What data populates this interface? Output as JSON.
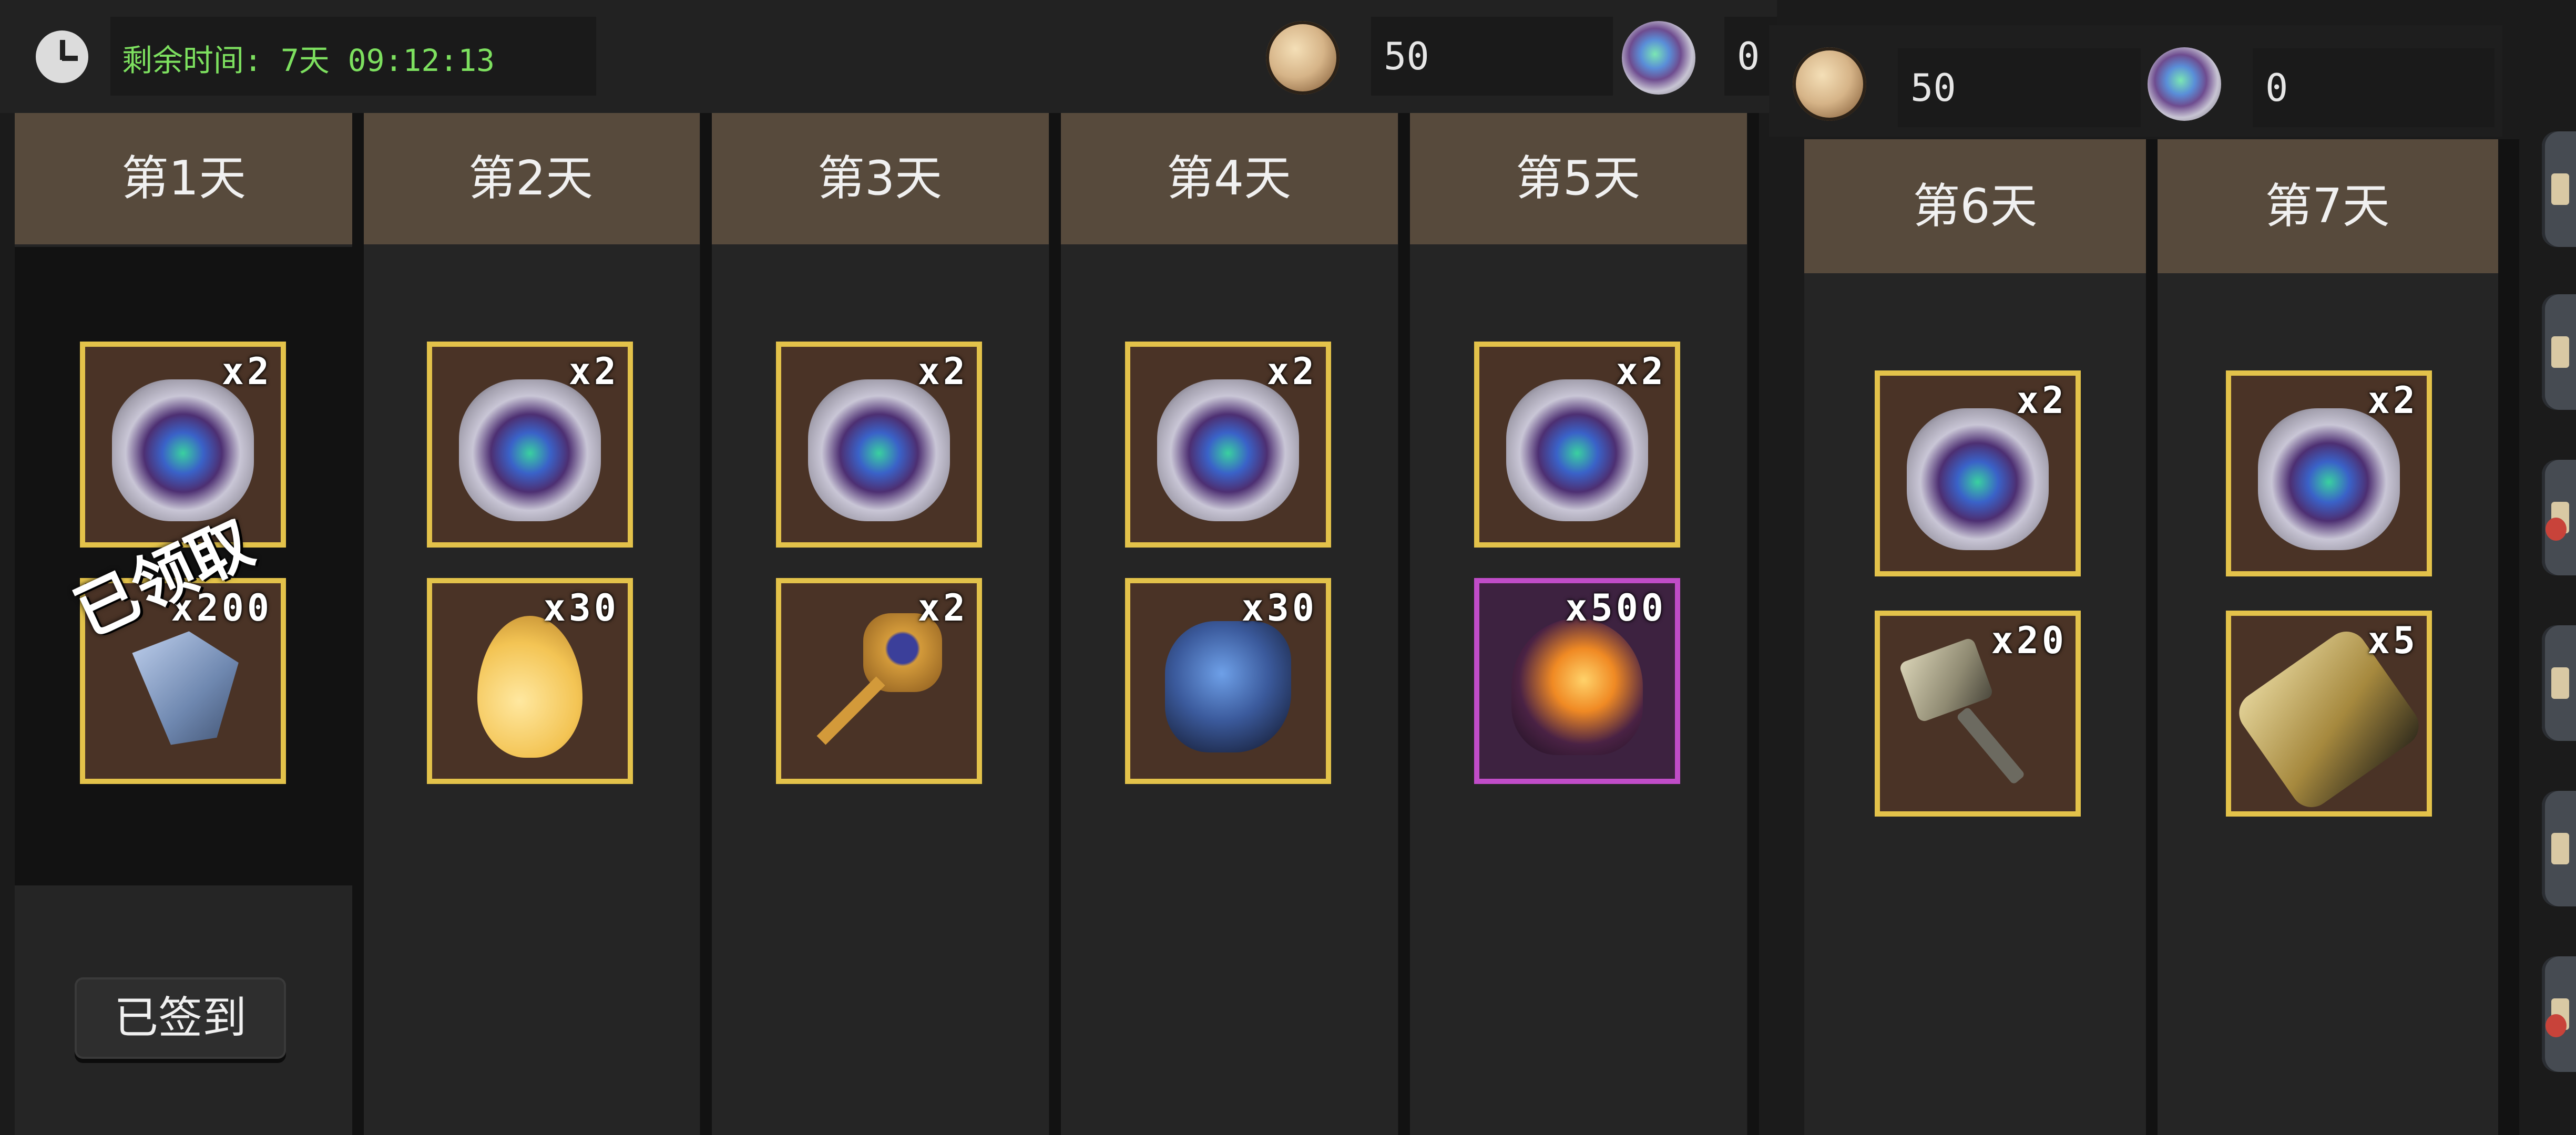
{
  "timer": {
    "label": "剩余时间: 7天 09:12:13"
  },
  "currency": {
    "main": {
      "gold": "50",
      "gem": "0"
    },
    "overlay": {
      "gold": "50",
      "gem": "0"
    }
  },
  "days": [
    {
      "label": "第1天",
      "status": "claimed",
      "stamp": "已领取",
      "button": "已签到",
      "items": [
        {
          "icon": "spirit-stone-icon",
          "qty": "x2"
        },
        {
          "icon": "crystal-shard-icon",
          "qty": "x200"
        }
      ]
    },
    {
      "label": "第2天",
      "items": [
        {
          "icon": "spirit-stone-icon",
          "qty": "x2"
        },
        {
          "icon": "golden-egg-icon",
          "qty": "x30"
        }
      ]
    },
    {
      "label": "第3天",
      "items": [
        {
          "icon": "spirit-stone-icon",
          "qty": "x2"
        },
        {
          "icon": "gold-key-icon",
          "qty": "x2"
        }
      ]
    },
    {
      "label": "第4天",
      "items": [
        {
          "icon": "spirit-stone-icon",
          "qty": "x2"
        },
        {
          "icon": "blue-ore-icon",
          "qty": "x30"
        }
      ]
    },
    {
      "label": "第5天",
      "items": [
        {
          "icon": "spirit-stone-icon",
          "qty": "x2"
        },
        {
          "icon": "flame-essence-icon",
          "qty": "x500",
          "rarity": "epic"
        }
      ]
    },
    {
      "label": "第6天",
      "items": [
        {
          "icon": "spirit-stone-icon",
          "qty": "x2"
        },
        {
          "icon": "iron-hammer-icon",
          "qty": "x20"
        }
      ]
    },
    {
      "label": "第7天",
      "items": [
        {
          "icon": "spirit-stone-icon",
          "qty": "x2"
        },
        {
          "icon": "ancient-scroll-icon",
          "qty": "x5"
        }
      ]
    }
  ],
  "colors": {
    "header": "#574a3c",
    "slot_border": "#e3c24a",
    "epic_border": "#c04cc8",
    "timer_text": "#7de05f"
  }
}
